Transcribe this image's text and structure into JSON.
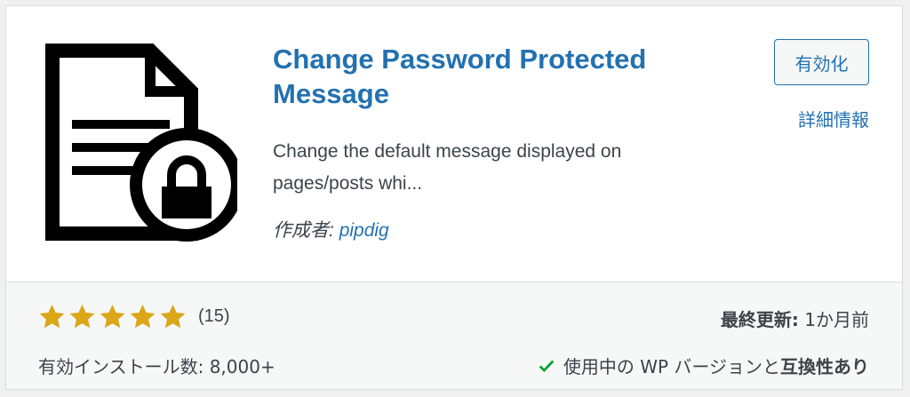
{
  "plugin": {
    "title_line1": "Change Password Protected",
    "title_line2": "Message",
    "desc_line1": "Change the default message displayed on",
    "desc_line2": "pages/posts whi...",
    "author_label": "作成者:",
    "author_name": "pipdig",
    "icon": "document-lock-icon"
  },
  "actions": {
    "activate_label": "有効化",
    "details_label": "詳細情報"
  },
  "footer": {
    "rating_stars": 5,
    "rating_count": "(15)",
    "installs": "有効インストール数: 8,000+",
    "updated_label": "最終更新:",
    "updated_value": "1か月前",
    "compat_prefix": "使用中の WP バージョンと",
    "compat_status": "互換性あり"
  },
  "colors": {
    "link": "#2271b1",
    "star": "#dba617",
    "check": "#00a32a"
  }
}
